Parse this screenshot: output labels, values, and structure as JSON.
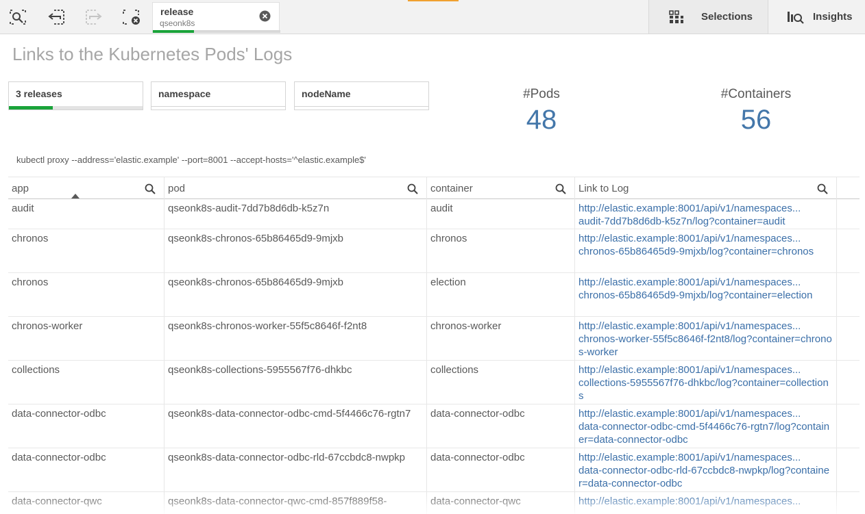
{
  "toolbar": {
    "buttons": [
      {
        "name": "smart-search-icon"
      },
      {
        "name": "step-back-icon"
      },
      {
        "name": "step-forward-icon"
      },
      {
        "name": "clear-selections-icon"
      }
    ],
    "selection_tab": {
      "title": "release",
      "subtitle": "qseonk8s",
      "progress": 0.32
    },
    "selections_label": "Selections",
    "insights_label": "Insights"
  },
  "sheet": {
    "title": "Links to the Kubernetes Pods' Logs",
    "filters": [
      {
        "label": "3 releases",
        "selected_fraction": 0.32
      },
      {
        "label": "namespace",
        "selected_fraction": 0
      },
      {
        "label": "nodeName",
        "selected_fraction": 0
      }
    ],
    "kpis": [
      {
        "label": "#Pods",
        "value": "48"
      },
      {
        "label": "#Containers",
        "value": "56"
      }
    ],
    "command_text": "kubectl proxy --address='elastic.example' --port=8001 --accept-hosts='^elastic.example$'"
  },
  "table": {
    "columns": [
      "app",
      "pod",
      "container",
      "Link to Log"
    ],
    "sorted_column": "app",
    "rows": [
      {
        "app": "audit",
        "pod": "qseonk8s-audit-7dd7b8d6db-k5z7n",
        "container": "audit",
        "link_first": "http://elastic.example:8001/api/v1/namespaces...",
        "link_rest": "audit-7dd7b8d6db-k5z7n/log?container=audit"
      },
      {
        "app": "chronos",
        "pod": "qseonk8s-chronos-65b86465d9-9mjxb",
        "container": "chronos",
        "link_first": "http://elastic.example:8001/api/v1/namespaces...",
        "link_rest": "chronos-65b86465d9-9mjxb/log?container=chronos"
      },
      {
        "app": "chronos",
        "pod": "qseonk8s-chronos-65b86465d9-9mjxb",
        "container": "election",
        "link_first": "http://elastic.example:8001/api/v1/namespaces...",
        "link_rest": "chronos-65b86465d9-9mjxb/log?container=election"
      },
      {
        "app": "chronos-worker",
        "pod": "qseonk8s-chronos-worker-55f5c8646f-f2nt8",
        "container": "chronos-worker",
        "link_first": "http://elastic.example:8001/api/v1/namespaces...",
        "link_rest": "chronos-worker-55f5c8646f-f2nt8/log?container=chronos-worker"
      },
      {
        "app": "collections",
        "pod": "qseonk8s-collections-5955567f76-dhkbc",
        "container": "collections",
        "link_first": "http://elastic.example:8001/api/v1/namespaces...",
        "link_rest": "collections-5955567f76-dhkbc/log?container=collections"
      },
      {
        "app": "data-connector-odbc",
        "pod": "qseonk8s-data-connector-odbc-cmd-5f4466c76-rgtn7",
        "container": "data-connector-odbc",
        "link_first": "http://elastic.example:8001/api/v1/namespaces...",
        "link_rest": "data-connector-odbc-cmd-5f4466c76-rgtn7/log?container=data-connector-odbc"
      },
      {
        "app": "data-connector-odbc",
        "pod": "qseonk8s-data-connector-odbc-rld-67ccbdc8-nwpkp",
        "container": "data-connector-odbc",
        "link_first": "http://elastic.example:8001/api/v1/namespaces...",
        "link_rest": "data-connector-odbc-rld-67ccbdc8-nwpkp/log?container=data-connector-odbc"
      },
      {
        "app": "data-connector-qwc",
        "pod": "qseonk8s-data-connector-qwc-cmd-857f889f58-",
        "container": "data-connector-qwc",
        "link_first": "http://elastic.example:8001/api/v1/namespaces...",
        "link_rest": ""
      }
    ]
  },
  "colors": {
    "accent_green": "#1aa33a",
    "kpi_blue": "#4477aa",
    "link_blue": "#3b6fa8",
    "orange_marker": "#f0a030"
  }
}
